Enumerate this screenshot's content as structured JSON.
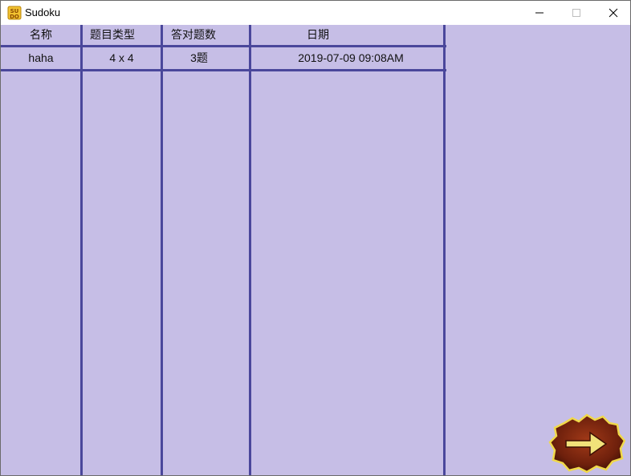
{
  "window": {
    "title": "Sudoku",
    "icon": "sudoku-app-icon",
    "controls": [
      "minimize-icon",
      "maximize-icon",
      "close-icon"
    ]
  },
  "table": {
    "headers": [
      "名称",
      "题目类型",
      "答对题数",
      "日期"
    ],
    "rows": [
      [
        "haha",
        "4 x 4",
        "3题",
        "2019-07-09 09:08AM"
      ]
    ]
  },
  "next_button": {
    "icon": "arrow-right-icon"
  },
  "colors": {
    "background": "#c6bee6",
    "grid_line": "#4a479b",
    "button_wood": "#7a2a12",
    "arrow": "#f1e27a"
  }
}
